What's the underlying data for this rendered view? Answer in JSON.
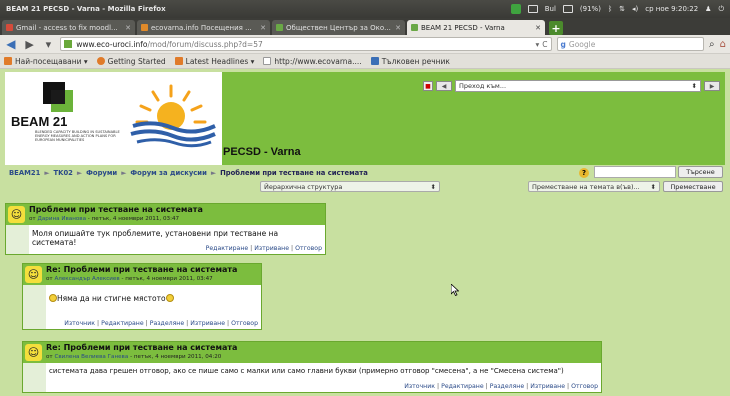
{
  "os": {
    "title": "BEAM 21 PECSD - Varna - Mozilla Firefox",
    "tray": [
      "Bul",
      "(91%)",
      "ср ное 9:20:22"
    ]
  },
  "tabs": [
    {
      "label": "Gmail - access to fix moodl...",
      "active": false,
      "color": "#d44b3a"
    },
    {
      "label": "ecovarna.info Посещения ...",
      "active": false,
      "color": "#e08a2a"
    },
    {
      "label": "Обществен Център за Око...",
      "active": false,
      "color": "#6aa846"
    },
    {
      "label": "BEAM 21 PECSD - Varna",
      "active": true,
      "color": "#6aa846"
    }
  ],
  "navbar": {
    "url_domain": "www.eco-uroci.info",
    "url_path": "/mod/forum/discuss.php?d=57",
    "search_placeholder": "Google"
  },
  "bookmarks": [
    {
      "label": "Най-посещавани ▾",
      "color": "#e07b2a"
    },
    {
      "label": "Getting Started",
      "color": "#e07b2a"
    },
    {
      "label": "Latest Headlines ▾",
      "color": "#e07b2a"
    },
    {
      "label": "http://www.ecovarna....",
      "color": "#cfcfcf"
    },
    {
      "label": "Тълковен речник",
      "color": "#3b6fb6"
    }
  ],
  "header": {
    "logo_text": "BEAM 21",
    "logo_sub": "BLENDED CAPACITY BUILDING IN SUSTAINABLE ENERGY MEASURES AND ACTION PLANS FOR EUROPEAN MUNICIPALITIES",
    "site_title": "PECSD - Varna",
    "jump_placeholder": "Преход към..."
  },
  "breadcrumbs": [
    "BEAM21",
    "TK02",
    "Форуми",
    "Форум за дискусии",
    "Проблеми при тестване на системата"
  ],
  "search_button": "Търсене",
  "controls": {
    "display_mode": "Йерархична структура",
    "move_select": "Преместване на темата в(ъв)...",
    "move_button": "Преместване"
  },
  "posts": [
    {
      "title": "Проблеми при тестване на системата",
      "author": "Дарина Иванова",
      "date": "петък, 4 ноември 2011, 03:47",
      "body": "Моля опишайте тук проблемите, установени при тестване на системата!",
      "links": [
        "Редактиране",
        "Изтриване",
        "Отговор"
      ]
    },
    {
      "title": "Re: Проблеми при тестване на системата",
      "author": "Александър Алексиев",
      "date": "петък, 4 ноември 2011, 03:47",
      "body": "Няма да ни стигне мястото",
      "links": [
        "Източник",
        "Редактиране",
        "Разделяне",
        "Изтриване",
        "Отговор"
      ]
    },
    {
      "title": "Re: Проблеми при тестване на системата",
      "author": "Свилена Велиева Ганева",
      "date": "петък, 4 ноември 2011, 04:20",
      "body": "системата дава грешен отговор, ако се пише само с малки или само главни букви (примерно отговор \"смесена\", а не \"Смесена система\")",
      "links": [
        "Източник",
        "Редактиране",
        "Разделяне",
        "Изтриване",
        "Отговор"
      ]
    }
  ]
}
